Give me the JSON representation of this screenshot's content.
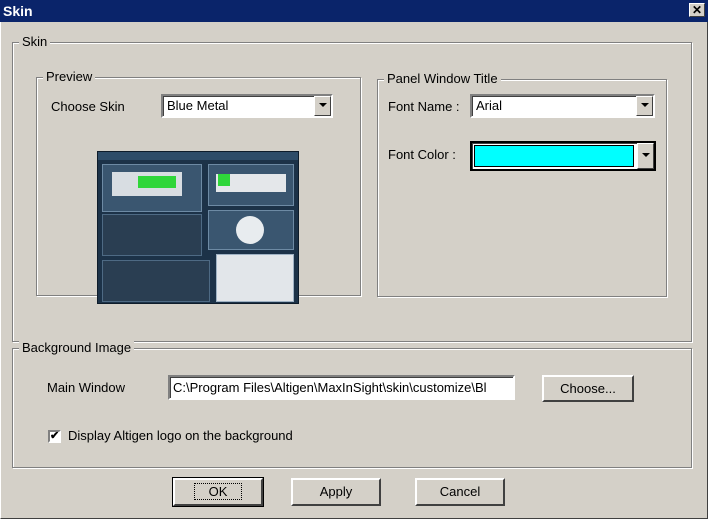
{
  "window": {
    "title": "Skin",
    "close_glyph": "✕"
  },
  "skin_group": {
    "label": "Skin"
  },
  "preview": {
    "label": "Preview",
    "choose_skin_label": "Choose Skin",
    "choose_skin_value": "Blue Metal"
  },
  "panel_title": {
    "label": "Panel Window Title",
    "font_name_label": "Font Name :",
    "font_name_value": "Arial",
    "font_color_label": "Font Color :",
    "font_color_value": "#00ffff"
  },
  "background": {
    "label": "Background Image",
    "main_window_label": "Main Window",
    "main_window_path": "C:\\Program Files\\Altigen\\MaxInSight\\skin\\customize\\Bl",
    "choose_button": "Choose...",
    "logo_checkbox_label": "Display Altigen logo on the background",
    "logo_checkbox_checked": true,
    "check_glyph": "✔"
  },
  "footer": {
    "ok": "OK",
    "apply": "Apply",
    "cancel": "Cancel"
  },
  "icons": {
    "close": "close-icon",
    "dropdown": "chevron-down-icon",
    "check": "checkmark-icon"
  }
}
